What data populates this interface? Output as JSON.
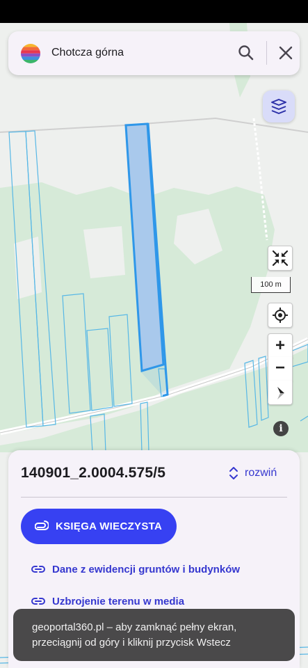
{
  "search": {
    "query": "Chotcza górna",
    "logo_icon": "rainbow-globe-icon",
    "search_icon": "search-icon",
    "close_icon": "close-icon"
  },
  "map": {
    "layers_icon": "layers-icon",
    "collapse_icon": "collapse-arrows-icon",
    "scale_label": "100 m",
    "locate_icon": "gps-locate-icon",
    "zoom_in_label": "+",
    "zoom_out_label": "−",
    "compass_icon": "compass-icon",
    "info_label": "i",
    "highlight_color": "#2f97e9",
    "parcel_line_color": "#56b7e6",
    "forest_color": "#d6ead8"
  },
  "sheet": {
    "parcel_id": "140901_2.0004.575/5",
    "expand_label": "rozwiń",
    "expand_icon": "unfold-chevrons-icon",
    "kw_button_label": "KSIĘGA WIECZYSTA",
    "kw_icon": "attachment-icon",
    "links": [
      {
        "label": "Dane z ewidencji gruntów i budynków",
        "icon": "link-icon"
      },
      {
        "label": "Uzbrojenie terenu w media",
        "icon": "link-icon"
      }
    ],
    "accent_color": "#3741f2"
  },
  "toast": {
    "line1": "geoportal360.pl – aby zamknąć pełny ekran,",
    "line2": "przeciągnij od góry i kliknij przycisk Wstecz"
  }
}
